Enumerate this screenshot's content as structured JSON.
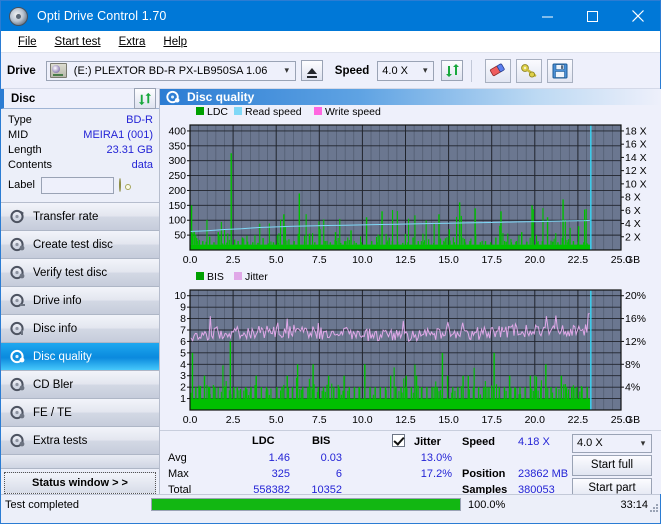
{
  "window": {
    "title": "Opti Drive Control 1.70",
    "icon": "disc-icon",
    "minimize": "minimize-icon",
    "maximize": "maximize-icon",
    "close": "close-icon"
  },
  "menu": {
    "items": [
      {
        "label": "File",
        "accel": "F"
      },
      {
        "label": "Start test",
        "accel": "S"
      },
      {
        "label": "Extra",
        "accel": "x"
      },
      {
        "label": "Help",
        "accel": "H"
      }
    ]
  },
  "toolbar": {
    "drive_label": "Drive",
    "drive_value": "(E:)  PLEXTOR BD-R  PX-LB950SA 1.06",
    "eject_icon": "eject-icon",
    "speed_label": "Speed",
    "speed_value": "4.0 X",
    "refresh_icon": "refresh-icon",
    "erase_icon": "eraser-icon",
    "key_icon": "key-icon",
    "save_icon": "save-icon"
  },
  "disc": {
    "header": "Disc",
    "refresh_icon": "refresh-icon",
    "rows": [
      {
        "key": "Type",
        "value": "BD-R"
      },
      {
        "key": "MID",
        "value": "MEIRA1 (001)"
      },
      {
        "key": "Length",
        "value": "23.31 GB"
      },
      {
        "key": "Contents",
        "value": "data"
      }
    ],
    "label_key": "Label",
    "label_value": "",
    "label_placeholder": "",
    "label_icon": "cd-icon"
  },
  "sidebar": {
    "items": [
      {
        "label": "Transfer rate",
        "icon": "disc-test-icon",
        "active": false
      },
      {
        "label": "Create test disc",
        "icon": "disc-test-icon",
        "active": false
      },
      {
        "label": "Verify test disc",
        "icon": "disc-test-icon",
        "active": false
      },
      {
        "label": "Drive info",
        "icon": "disc-test-icon",
        "active": false
      },
      {
        "label": "Disc info",
        "icon": "disc-test-icon",
        "active": false
      },
      {
        "label": "Disc quality",
        "icon": "disc-test-icon",
        "active": true
      },
      {
        "label": "CD Bler",
        "icon": "disc-test-icon",
        "active": false
      },
      {
        "label": "FE / TE",
        "icon": "disc-test-icon",
        "active": false
      },
      {
        "label": "Extra tests",
        "icon": "disc-test-icon",
        "active": false
      }
    ],
    "status_window_button": "Status window > >"
  },
  "main": {
    "section_title": "Disc quality",
    "section_icon": "disc-test-icon"
  },
  "chart_data": [
    {
      "type": "line",
      "id": "ldc-chart",
      "title": "",
      "legend": [
        {
          "label": "LDC",
          "color": "#00a000"
        },
        {
          "label": "Read speed",
          "color": "#7fd8f7"
        },
        {
          "label": "Write speed",
          "color": "#ff66e0"
        }
      ],
      "legend_position": "top-left",
      "grid": true,
      "xlabel": "GB",
      "x_ticks": [
        "0.0",
        "2.5",
        "5.0",
        "7.5",
        "10.0",
        "12.5",
        "15.0",
        "17.5",
        "20.0",
        "22.5",
        "25.0"
      ],
      "xlim": [
        0,
        25
      ],
      "ylabel_left": "LDC",
      "y_ticks_left": [
        "400",
        "350",
        "300",
        "250",
        "200",
        "150",
        "100",
        "50"
      ],
      "ylim_left": [
        0,
        420
      ],
      "ylabel_right": "Speed",
      "y_ticks_right": [
        "18 X",
        "16 X",
        "14 X",
        "12 X",
        "10 X",
        "8 X",
        "6 X",
        "4 X",
        "2 X"
      ],
      "ylim_right": [
        0,
        18.9
      ],
      "series": [
        {
          "name": "LDC",
          "color": "#00c000",
          "kind": "spikes",
          "baseline": 18,
          "x": [
            0.05,
            0.2,
            0.35,
            0.5,
            0.7,
            0.9,
            1.1,
            1.35,
            1.6,
            1.85,
            2.1,
            2.35,
            2.55,
            2.75,
            3.0,
            3.3,
            3.6,
            3.9,
            4.2,
            4.5,
            4.8,
            5.1,
            5.4,
            5.7,
            6.0,
            6.3,
            6.6,
            6.9,
            7.2,
            7.5,
            7.8,
            8.1,
            8.4,
            8.7,
            9.0,
            9.3,
            9.6,
            9.9,
            10.2,
            10.5,
            10.8,
            11.1,
            11.4,
            11.7,
            12.0,
            12.3,
            12.6,
            12.9,
            13.2,
            13.5,
            13.8,
            14.1,
            14.4,
            14.7,
            15.0,
            15.3,
            15.6,
            15.9,
            16.2,
            16.5,
            16.8,
            17.1,
            17.4,
            17.7,
            18.0,
            18.3,
            18.6,
            18.9,
            19.2,
            19.5,
            19.8,
            20.1,
            20.4,
            20.7,
            21.0,
            21.3,
            21.6,
            21.9,
            22.2,
            22.5,
            22.8,
            23.0
          ],
          "y": [
            150,
            62,
            40,
            34,
            30,
            28,
            45,
            26,
            60,
            22,
            25,
            325,
            35,
            30,
            42,
            28,
            26,
            24,
            40,
            22,
            26,
            24,
            120,
            36,
            30,
            190,
            28,
            55,
            26,
            70,
            30,
            26,
            60,
            24,
            30,
            66,
            24,
            26,
            110,
            30,
            26,
            130,
            26,
            30,
            28,
            24,
            26,
            42,
            30,
            26,
            36,
            24,
            120,
            26,
            70,
            26,
            160,
            26,
            30,
            140,
            26,
            30,
            26,
            42,
            130,
            28,
            26,
            30,
            60,
            28,
            150,
            26,
            30,
            110,
            28,
            26,
            170,
            26,
            30,
            80,
            26,
            22
          ]
        },
        {
          "name": "Read speed",
          "color": "#7fd8f7",
          "kind": "line",
          "x": [
            0.0,
            1.0,
            2.0,
            3.0,
            4.0,
            5.0,
            6.0,
            7.0,
            8.0,
            9.0,
            10.0,
            11.0,
            12.0,
            13.0,
            14.0,
            15.0,
            16.0,
            17.0,
            18.0,
            19.0,
            20.0,
            21.0,
            22.0,
            23.0,
            23.2
          ],
          "y": [
            2.8,
            2.9,
            3.1,
            3.2,
            3.4,
            3.5,
            3.6,
            3.65,
            3.7,
            3.75,
            3.8,
            3.85,
            3.9,
            3.95,
            4.0,
            4.05,
            4.1,
            4.15,
            4.2,
            4.25,
            4.3,
            4.35,
            4.4,
            4.45,
            4.5
          ]
        }
      ],
      "cursor_x": 23.25,
      "cursor_color": "#38d6f5",
      "plot_bg": "#6b7790"
    },
    {
      "type": "line",
      "id": "bis-jitter-chart",
      "title": "",
      "legend": [
        {
          "label": "BIS",
          "color": "#00a000"
        },
        {
          "label": "Jitter",
          "color": "#e0a8e8"
        }
      ],
      "legend_position": "top-left",
      "grid": true,
      "xlabel": "GB",
      "x_ticks": [
        "0.0",
        "2.5",
        "5.0",
        "7.5",
        "10.0",
        "12.5",
        "15.0",
        "17.5",
        "20.0",
        "22.5",
        "25.0"
      ],
      "xlim": [
        0,
        25
      ],
      "ylabel_left": "BIS",
      "y_ticks_left": [
        "10",
        "9",
        "8",
        "7",
        "6",
        "5",
        "4",
        "3",
        "2",
        "1"
      ],
      "ylim_left": [
        0,
        10.5
      ],
      "ylabel_right": "Jitter",
      "y_ticks_right": [
        "20%",
        "16%",
        "12%",
        "8%",
        "4%"
      ],
      "ylim_right": [
        0,
        21
      ],
      "series": [
        {
          "name": "BIS",
          "color": "#00c000",
          "kind": "spikes",
          "baseline": 1,
          "x": [
            0.1,
            0.3,
            0.5,
            0.8,
            1.1,
            1.4,
            1.7,
            2.0,
            2.3,
            2.5,
            2.7,
            2.9,
            3.2,
            3.5,
            3.8,
            4.1,
            4.4,
            4.7,
            5.0,
            5.3,
            5.6,
            5.9,
            6.2,
            6.5,
            6.8,
            7.1,
            7.4,
            7.7,
            8.0,
            8.3,
            8.6,
            8.9,
            9.2,
            9.5,
            9.8,
            10.1,
            10.4,
            10.7,
            11.0,
            11.3,
            11.6,
            11.9,
            12.2,
            12.5,
            12.8,
            13.1,
            13.4,
            13.7,
            14.0,
            14.3,
            14.6,
            14.9,
            15.2,
            15.5,
            15.8,
            16.1,
            16.4,
            16.7,
            17.0,
            17.3,
            17.6,
            17.9,
            18.2,
            18.5,
            18.8,
            19.1,
            19.4,
            19.7,
            20.0,
            20.3,
            20.6,
            20.9,
            21.2,
            21.5,
            21.8,
            22.1,
            22.4,
            22.7,
            23.0
          ],
          "y": [
            5,
            2,
            2,
            3,
            2,
            2,
            1,
            2,
            6,
            2,
            2,
            1,
            2,
            2,
            3,
            2,
            2,
            1,
            2,
            2,
            3,
            2,
            4,
            2,
            2,
            4,
            2,
            2,
            3,
            2,
            2,
            3,
            2,
            2,
            2,
            4,
            2,
            2,
            2,
            2,
            3,
            2,
            2,
            3,
            2,
            3,
            2,
            2,
            2,
            2,
            5,
            3,
            2,
            2,
            3,
            3,
            2,
            2,
            2,
            2,
            5,
            2,
            2,
            3,
            2,
            2,
            2,
            3,
            2,
            2,
            4,
            2,
            2,
            3,
            2,
            2,
            2,
            2,
            2
          ]
        },
        {
          "name": "Jitter",
          "color": "#e0a8e8",
          "kind": "line",
          "avg": 6.6,
          "min": 5.6,
          "max": 8.6
        }
      ],
      "cursor_x": 23.25,
      "cursor_color": "#38d6f5",
      "plot_bg": "#6b7790"
    }
  ],
  "stats": {
    "col_headers": [
      "LDC",
      "BIS"
    ],
    "row_labels": [
      "Avg",
      "Max",
      "Total"
    ],
    "ldc": {
      "avg": "1.46",
      "max": "325",
      "total": "558382"
    },
    "bis": {
      "avg": "0.03",
      "max": "6",
      "total": "10352"
    },
    "jitter": {
      "label": "Jitter",
      "checked": true,
      "avg": "13.0%",
      "max": "17.2%"
    },
    "speed_label": "Speed",
    "speed_value": "4.18 X",
    "position_label": "Position",
    "position_value": "23862 MB",
    "samples_label": "Samples",
    "samples_value": "380053",
    "speed_select": "4.0 X",
    "start_full_button": "Start full",
    "start_part_button": "Start part"
  },
  "statusbar": {
    "text": "Test completed",
    "progress_percent": "100.0%",
    "progress_value": 100,
    "elapsed": "33:14"
  },
  "colors": {
    "accent": "#0078d7",
    "value_text": "#2424d6",
    "progress": "#12b712",
    "plot_bg": "#6b7790",
    "ldc_green": "#00c000",
    "jitter_pink": "#e0a8e8",
    "cursor": "#38d6f5"
  }
}
